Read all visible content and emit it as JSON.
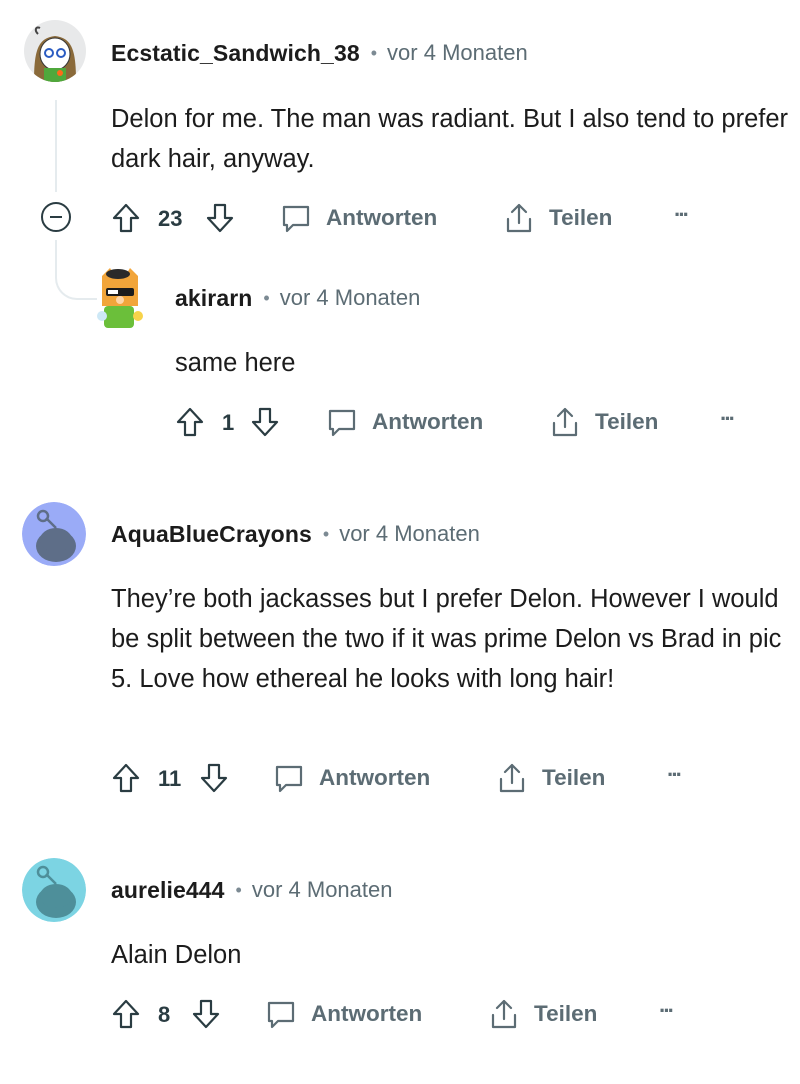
{
  "comments": [
    {
      "username": "Ecstatic_Sandwich_38",
      "time": "vor 4 Monaten",
      "text": "Delon for me. The man was radiant. But I also tend to prefer dark hair, anyway.",
      "votes": "23",
      "reply_label": "Antworten",
      "share_label": "Teilen",
      "more_label": "···"
    },
    {
      "username": "akirarn",
      "time": "vor 4 Monaten",
      "text": "same here",
      "votes": "1",
      "reply_label": "Antworten",
      "share_label": "Teilen",
      "more_label": "···"
    },
    {
      "username": "AquaBlueCrayons",
      "time": "vor 4 Monaten",
      "text": "They’re both jackasses but I prefer Delon. However I would be split between the two if it was prime Delon vs Brad in pic 5. Love how ethereal he looks with long hair!",
      "votes": "11",
      "reply_label": "Antworten",
      "share_label": "Teilen",
      "more_label": "···"
    },
    {
      "username": "aurelie444",
      "time": "vor 4 Monaten",
      "text": "Alain Delon",
      "votes": "8",
      "reply_label": "Antworten",
      "share_label": "Teilen",
      "more_label": "···"
    }
  ],
  "colors": {
    "avatar_blue": "#9aabf7",
    "avatar_teal": "#7cd4e3",
    "meta_gray": "#5c6c74",
    "thread_line": "#e5ebee"
  },
  "icons": [
    "upvote-icon",
    "downvote-icon",
    "comment-bubble-icon",
    "share-icon",
    "more-icon",
    "collapse-icon"
  ]
}
